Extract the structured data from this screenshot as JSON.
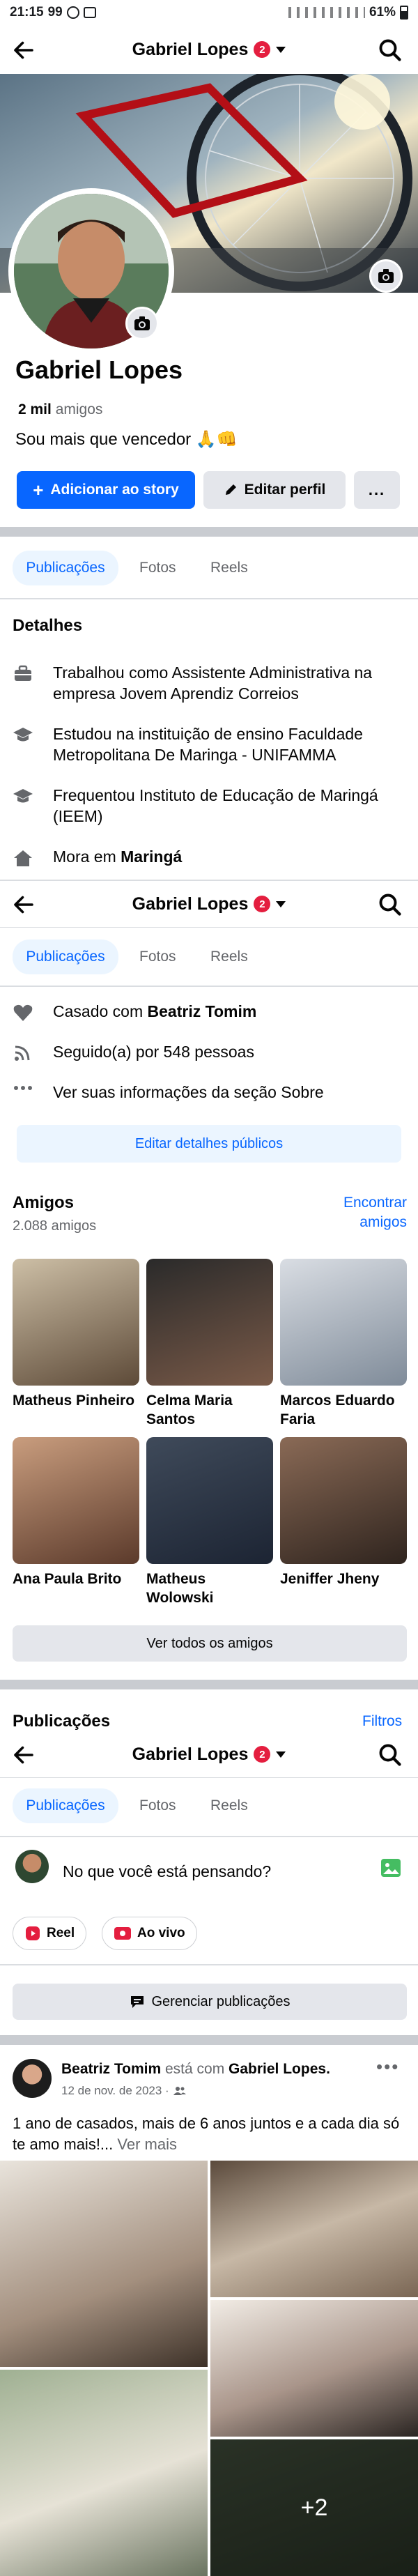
{
  "status_bar": {
    "time": "21:15",
    "left_icons": "99",
    "battery": "61%"
  },
  "header": {
    "name": "Gabriel Lopes",
    "badge": "2"
  },
  "profile": {
    "name": "Gabriel Lopes",
    "friends_count": "2 mil",
    "friends_label": "amigos",
    "bio": "Sou mais que vencedor 🙏👊",
    "add_story_label": "Adicionar ao story",
    "edit_profile_label": "Editar perfil",
    "more_label": "..."
  },
  "tabs": [
    "Publicações",
    "Fotos",
    "Reels"
  ],
  "details": {
    "title": "Detalhes",
    "items": [
      {
        "icon": "briefcase-icon",
        "text": "Trabalhou como Assistente Administrativa na empresa Jovem Aprendiz Correios"
      },
      {
        "icon": "graduation-cap-icon",
        "text": "Estudou na instituição de ensino Faculdade Metropolitana De Maringa - UNIFAMMA"
      },
      {
        "icon": "graduation-cap-icon",
        "text": "Frequentou Instituto de Educação de Maringá (IEEM)"
      }
    ],
    "lives_prefix": "Mora em ",
    "lives_city": "Maringá",
    "married_prefix": "Casado com ",
    "married_name": "Beatriz Tomim",
    "followers": "Seguido(a) por 548 pessoas",
    "about": "Ver suas informações da seção Sobre",
    "edit_public": "Editar detalhes públicos"
  },
  "friends": {
    "title": "Amigos",
    "count": "2.088 amigos",
    "find": "Encontrar amigos",
    "see_all": "Ver todos os amigos",
    "items": [
      {
        "name": "Matheus Pinheiro"
      },
      {
        "name": "Celma Maria Santos"
      },
      {
        "name": "Marcos Eduardo Faria"
      },
      {
        "name": "Ana Paula Brito"
      },
      {
        "name": "Matheus Wolowski"
      },
      {
        "name": "Jeniffer Jheny"
      }
    ]
  },
  "posts_section": {
    "title": "Publicações",
    "filters": "Filtros",
    "composer_placeholder": "No que você está pensando?",
    "reel_label": "Reel",
    "live_label": "Ao vivo",
    "manage_label": "Gerenciar publicações"
  },
  "post": {
    "author": "Beatriz Tomim",
    "with_text": "está com",
    "tagged": "Gabriel Lopes.",
    "date": "12 de nov. de 2023 ·",
    "text": "1 ano de casados, mais de 6 anos juntos e a cada dia só te amo mais!...",
    "see_more": "Ver mais",
    "more_photos": "+2"
  },
  "colors": {
    "accent": "#0866ff",
    "badge": "#e41e3f",
    "divider": "#c9ccd1"
  }
}
